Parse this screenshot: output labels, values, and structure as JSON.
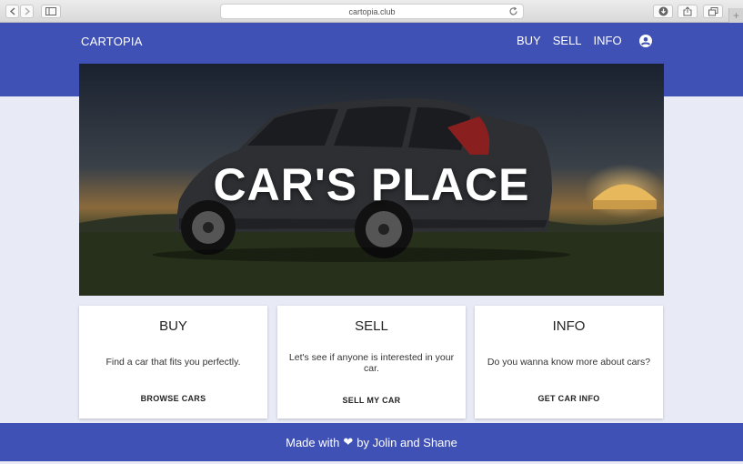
{
  "browser": {
    "url": "cartopia.club"
  },
  "nav": {
    "brand": "CARTOPIA",
    "links": [
      "BUY",
      "SELL",
      "INFO"
    ]
  },
  "hero": {
    "title": "CAR'S PLACE"
  },
  "cards": [
    {
      "title": "BUY",
      "text": "Find a car that fits you perfectly.",
      "action": "BROWSE CARS"
    },
    {
      "title": "SELL",
      "text": "Let's see if anyone is interested in your car.",
      "action": "SELL MY CAR"
    },
    {
      "title": "INFO",
      "text": "Do you wanna know more about cars?",
      "action": "GET CAR INFO"
    }
  ],
  "footer": {
    "prefix": "Made with",
    "heart": "❤",
    "suffix": "by Jolin and Shane"
  },
  "colors": {
    "primary": "#3f51b5",
    "background": "#e8eaf6"
  },
  "icons": [
    "back-icon",
    "forward-icon",
    "sidebar-icon",
    "reload-icon",
    "download-icon",
    "share-icon",
    "tabs-icon",
    "account-circle-icon",
    "heart-icon"
  ]
}
